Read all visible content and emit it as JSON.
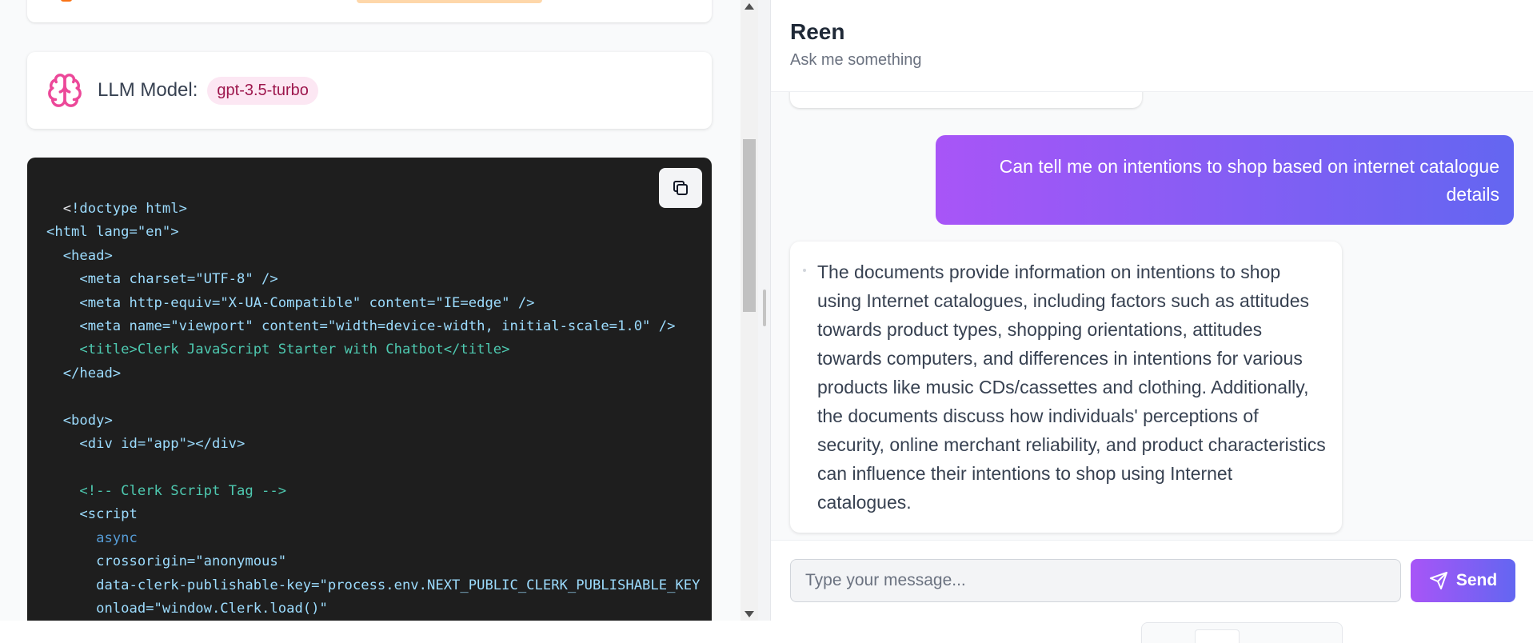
{
  "model": {
    "label": "LLM Model:",
    "value": "gpt-3.5-turbo"
  },
  "code": {
    "copy_icon": "copy-icon",
    "lines": [
      "<!doctype html>",
      "<html lang=\"en\">",
      "<head>",
      "<meta charset=\"UTF-8\" />",
      "<meta http-equiv=\"X-UA-Compatible\" content=\"IE=edge\" />",
      "<meta name=\"viewport\" content=\"width=device-width, initial-scale=1.0\" />",
      "<title>Clerk JavaScript Starter with Chatbot</title>",
      "</head>",
      "<body>",
      "<div id=\"app\"></div>",
      "<!-- Clerk Script Tag -->",
      "<script",
      "async",
      "crossorigin=\"anonymous\"",
      "data-clerk-publishable-key=\"process.env.NEXT_PUBLIC_CLERK_PUBLISHABLE_KEY",
      "onload=\"window.Clerk.load()\""
    ]
  },
  "chat": {
    "title": "Reen",
    "subtitle": "Ask me something",
    "messages": [
      {
        "role": "user",
        "text": "Can tell me on intentions to shop based on internet catalogue details"
      },
      {
        "role": "assistant",
        "text": "The documents provide information on intentions to shop using Internet catalogues, including factors such as attitudes towards product types, shopping orientations, attitudes towards computers, and differences in intentions for various products like music CDs/cassettes and clothing. Additionally, the documents discuss how individuals' perceptions of security, online merchant reliability, and product characteristics can influence their intentions to shop using Internet catalogues."
      }
    ],
    "input": {
      "placeholder": "Type your message...",
      "value": ""
    },
    "send_label": "Send"
  },
  "colors": {
    "accent_gradient_start": "#a855f7",
    "accent_gradient_end": "#6366f1",
    "brain_icon": "#ec4899",
    "badge_bg": "#fce7f3",
    "badge_text": "#9d174d",
    "code_bg": "#1e1e1e"
  }
}
